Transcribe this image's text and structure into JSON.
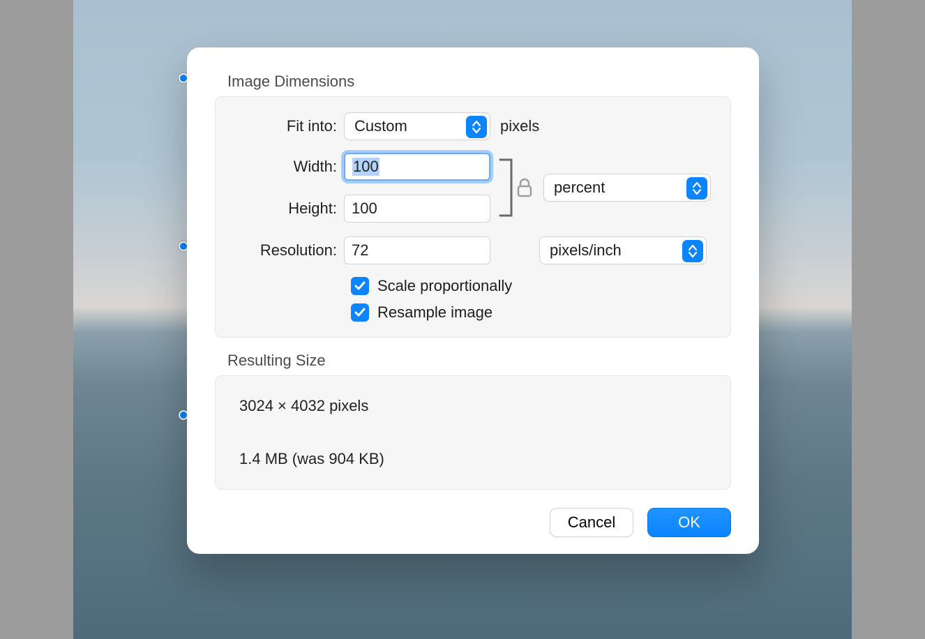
{
  "dialog": {
    "section_image_dimensions": "Image Dimensions",
    "fit_into_label": "Fit into:",
    "fit_into_value": "Custom",
    "fit_into_unit": "pixels",
    "width_label": "Width:",
    "width_value": "100",
    "height_label": "Height:",
    "height_value": "100",
    "wh_unit_value": "percent",
    "resolution_label": "Resolution:",
    "resolution_value": "72",
    "resolution_unit_value": "pixels/inch",
    "scale_proportionally_label": "Scale proportionally",
    "scale_proportionally_checked": true,
    "resample_image_label": "Resample image",
    "resample_image_checked": true,
    "section_resulting_size": "Resulting Size",
    "result_dimensions": "3024 × 4032 pixels",
    "result_filesize": "1.4 MB (was 904 KB)",
    "cancel_label": "Cancel",
    "ok_label": "OK"
  }
}
